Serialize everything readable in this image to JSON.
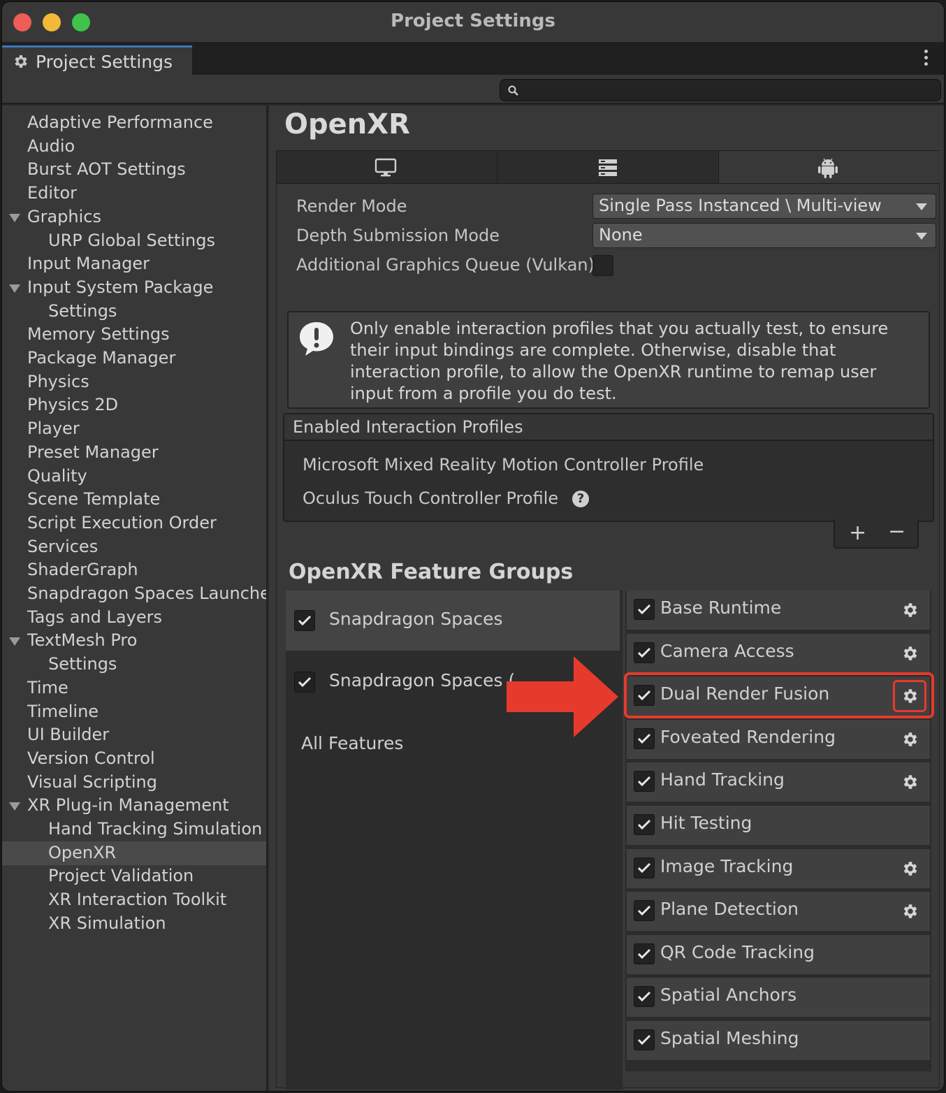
{
  "window": {
    "title": "Project Settings"
  },
  "tab": {
    "label": "Project Settings",
    "icon": "gear-icon"
  },
  "search": {
    "placeholder": "",
    "value": ""
  },
  "sidebar": {
    "items": [
      {
        "label": "Adaptive Performance",
        "level": 0
      },
      {
        "label": "Audio",
        "level": 0
      },
      {
        "label": "Burst AOT Settings",
        "level": 0
      },
      {
        "label": "Editor",
        "level": 0
      },
      {
        "label": "Graphics",
        "level": 0,
        "expanded": true
      },
      {
        "label": "URP Global Settings",
        "level": 1
      },
      {
        "label": "Input Manager",
        "level": 0
      },
      {
        "label": "Input System Package",
        "level": 0,
        "expanded": true
      },
      {
        "label": "Settings",
        "level": 1
      },
      {
        "label": "Memory Settings",
        "level": 0
      },
      {
        "label": "Package Manager",
        "level": 0
      },
      {
        "label": "Physics",
        "level": 0
      },
      {
        "label": "Physics 2D",
        "level": 0
      },
      {
        "label": "Player",
        "level": 0
      },
      {
        "label": "Preset Manager",
        "level": 0
      },
      {
        "label": "Quality",
        "level": 0
      },
      {
        "label": "Scene Template",
        "level": 0
      },
      {
        "label": "Script Execution Order",
        "level": 0
      },
      {
        "label": "Services",
        "level": 0
      },
      {
        "label": "ShaderGraph",
        "level": 0
      },
      {
        "label": "Snapdragon Spaces Launche",
        "level": 0
      },
      {
        "label": "Tags and Layers",
        "level": 0
      },
      {
        "label": "TextMesh Pro",
        "level": 0,
        "expanded": true
      },
      {
        "label": "Settings",
        "level": 1
      },
      {
        "label": "Time",
        "level": 0
      },
      {
        "label": "Timeline",
        "level": 0
      },
      {
        "label": "UI Builder",
        "level": 0
      },
      {
        "label": "Version Control",
        "level": 0
      },
      {
        "label": "Visual Scripting",
        "level": 0
      },
      {
        "label": "XR Plug-in Management",
        "level": 0,
        "expanded": true
      },
      {
        "label": "Hand Tracking Simulation",
        "level": 1
      },
      {
        "label": "OpenXR",
        "level": 1,
        "selected": true
      },
      {
        "label": "Project Validation",
        "level": 1
      },
      {
        "label": "XR Interaction Toolkit",
        "level": 1
      },
      {
        "label": "XR Simulation",
        "level": 1
      }
    ]
  },
  "main": {
    "title": "OpenXR",
    "platform_tabs": [
      {
        "icon": "desktop-icon",
        "active": false
      },
      {
        "icon": "server-icon",
        "active": false
      },
      {
        "icon": "android-icon",
        "active": true
      }
    ],
    "render_mode": {
      "label": "Render Mode",
      "value": "Single Pass Instanced \\ Multi-view"
    },
    "depth_submission": {
      "label": "Depth Submission Mode",
      "value": "None"
    },
    "graphics_queue": {
      "label": "Additional Graphics Queue (Vulkan)",
      "checked": false
    },
    "help_text": "Only enable interaction profiles that you actually test, to ensure their input bindings are complete. Otherwise, disable that interaction profile, to allow the OpenXR runtime to remap user input from a profile you do test.",
    "profiles": {
      "header": "Enabled Interaction Profiles",
      "items": [
        "Microsoft Mixed Reality Motion Controller Profile",
        "Oculus Touch Controller Profile"
      ],
      "add_label": "+",
      "remove_label": "−"
    },
    "feature_groups_title": "OpenXR Feature Groups",
    "groups": [
      {
        "label": "Snapdragon Spaces",
        "checked": true,
        "selected": true
      },
      {
        "label": "Snapdragon Spaces (",
        "checked": true,
        "selected": false
      }
    ],
    "all_features_label": "All Features",
    "features": [
      {
        "label": "Base Runtime",
        "checked": true,
        "has_settings": true
      },
      {
        "label": "Camera Access",
        "checked": true,
        "has_settings": true
      },
      {
        "label": "Dual Render Fusion",
        "checked": true,
        "has_settings": true,
        "highlighted": true
      },
      {
        "label": "Foveated Rendering",
        "checked": true,
        "has_settings": true
      },
      {
        "label": "Hand Tracking",
        "checked": true,
        "has_settings": true
      },
      {
        "label": "Hit Testing",
        "checked": true,
        "has_settings": false
      },
      {
        "label": "Image Tracking",
        "checked": true,
        "has_settings": true
      },
      {
        "label": "Plane Detection",
        "checked": true,
        "has_settings": true
      },
      {
        "label": "QR Code Tracking",
        "checked": true,
        "has_settings": false
      },
      {
        "label": "Spatial Anchors",
        "checked": true,
        "has_settings": false
      },
      {
        "label": "Spatial Meshing",
        "checked": true,
        "has_settings": false
      }
    ]
  },
  "annotation": {
    "color": "#e63a2c"
  }
}
